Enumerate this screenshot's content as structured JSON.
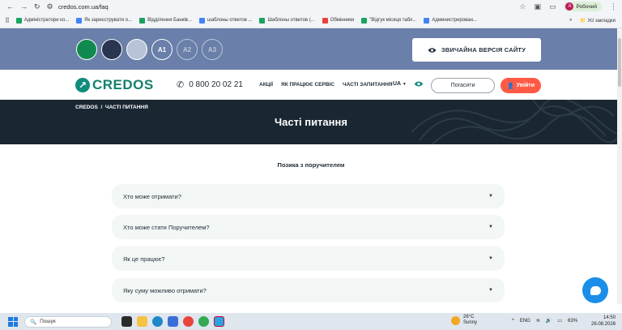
{
  "browser": {
    "url": "credos.com.ua/faq",
    "profile_initial": "А",
    "profile_name": "Робочий",
    "bookmarks": [
      {
        "label": "Адміністратори ко...",
        "color": "#1aa260"
      },
      {
        "label": "Як зареєструвати о...",
        "color": "#4285f4"
      },
      {
        "label": "Відділення Банків...",
        "color": "#1aa260"
      },
      {
        "label": "шаблоны ответов ...",
        "color": "#4285f4"
      },
      {
        "label": "Шаблоны ответов (...",
        "color": "#1aa260"
      },
      {
        "label": "Обмінники",
        "color": "#ea4335"
      },
      {
        "label": "\"Відгук місяця табл...",
        "color": "#1aa260"
      },
      {
        "label": "Администрирован...",
        "color": "#4285f4"
      }
    ],
    "all_bookmarks": "Усі закладки"
  },
  "accessibility": {
    "swatches": [
      "#108a4e",
      "#2a3550",
      "#b9c3d8"
    ],
    "sizes": [
      "A1",
      "A2",
      "A3"
    ],
    "normal_version": "ЗВИЧАЙНА ВЕРСІЯ САЙТУ"
  },
  "header": {
    "logo": "CREDOS",
    "phone": "0 800 20 02 21",
    "menu": [
      "АКЦІЇ",
      "ЯК ПРАЦЮЄ СЕРВІС",
      "ЧАСТІ ЗАПИТАННЯ"
    ],
    "lang": "UA",
    "repay": "Погасити",
    "login": "Увійти"
  },
  "hero": {
    "crumb_home": "CREDOS",
    "crumb_sep": "/",
    "crumb_current": "ЧАСТІ ПИТАННЯ",
    "title": "Часті питання"
  },
  "faq": {
    "section": "Позика з поручителем",
    "items": [
      "Хто може отримати?",
      "Хто може стати Поручителем?",
      "Як це працює?",
      "Яку суму можливо отримати?"
    ]
  },
  "taskbar": {
    "search": "Пошук",
    "temp": "26°C",
    "weather": "Sunny",
    "lang": "ENG",
    "battery": "63%",
    "time": "14:50",
    "date": "26.08.2026"
  }
}
